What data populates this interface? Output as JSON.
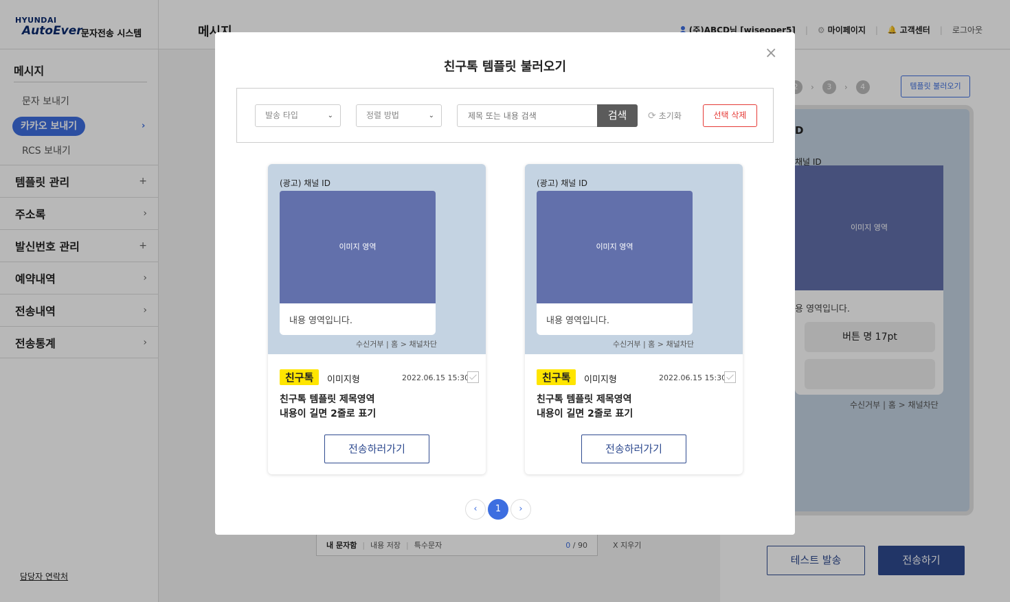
{
  "sidebar": {
    "logo_top": "HYUNDAI",
    "logo_main": "AutoEver",
    "logo_system": "문자전송 시스템",
    "section_title": "메시지",
    "sub_items": [
      "문자 보내기",
      "카카오 보내기",
      "RCS 보내기"
    ],
    "items": [
      {
        "label": "템플릿 관리",
        "mark": "+"
      },
      {
        "label": "주소록",
        "mark": "›"
      },
      {
        "label": "발신번호 관리",
        "mark": "+"
      },
      {
        "label": "예약내역",
        "mark": "›"
      },
      {
        "label": "전송내역",
        "mark": "›"
      },
      {
        "label": "전송통계",
        "mark": "›"
      }
    ],
    "contact": "담당자 연락처"
  },
  "header": {
    "title": "메시지",
    "user": "(주)ABCD님 [wiseoper5]",
    "mypage": "마이페이지",
    "support": "고객센터",
    "logout": "로그아웃"
  },
  "background": {
    "editor": {
      "inbox": "내 문자함",
      "save": "내용 저장",
      "special": "특수문자",
      "count_now": "0",
      "count_max": "/ 90"
    },
    "clear": "X  지우기",
    "steps": [
      "2",
      "3",
      "4"
    ],
    "load_template_button": "템플릿 불러오기",
    "phone": {
      "channel_big": "D",
      "channel": "채널 ID",
      "image_label": "이미지 영역",
      "body_text": "용 영역입니다.",
      "button_label": "버튼 명 17pt",
      "footer": "수신거부 | 홈 > 채널차단"
    },
    "test_send": "테스트 발송",
    "send": "전송하기"
  },
  "modal": {
    "title": "친구톡 템플릿 불러오기",
    "close": "×",
    "filters": {
      "send_type": "발송 타입",
      "sort": "정렬 방법",
      "search_placeholder": "제목 또는 내용 검색",
      "search_button": "검색",
      "reset": "초기화",
      "delete_selected": "선택 삭제"
    },
    "cards": [
      {
        "channel": "(광고) 채널 ID",
        "image_label": "이미지 영역",
        "body_text": "내용 영역입니다.",
        "footer": "수신거부 | 홈 > 채널차단",
        "badge": "친구톡",
        "type": "이미지형",
        "date": "2022.06.15 15:30",
        "title_line1": "친구톡 템플릿 제목영역",
        "title_line2": "내용이 길면 2줄로 표기",
        "button": "전송하러가기"
      },
      {
        "channel": "(광고) 채널 ID",
        "image_label": "이미지 영역",
        "body_text": "내용 영역입니다.",
        "footer": "수신거부 | 홈 > 채널차단",
        "badge": "친구톡",
        "type": "이미지형",
        "date": "2022.06.15 15:30",
        "title_line1": "친구톡 템플릿 제목영역",
        "title_line2": "내용이 길면 2줄로 표기",
        "button": "전송하러가기"
      }
    ],
    "pagination": {
      "prev": "‹",
      "current": "1",
      "next": "›"
    }
  },
  "colors": {
    "accent": "#3d6ee0",
    "navy": "#2e4a8f",
    "danger": "#e53935",
    "badge": "#ffe500",
    "image_area": "#6270ab",
    "preview_bg": "#c4d3e2"
  }
}
